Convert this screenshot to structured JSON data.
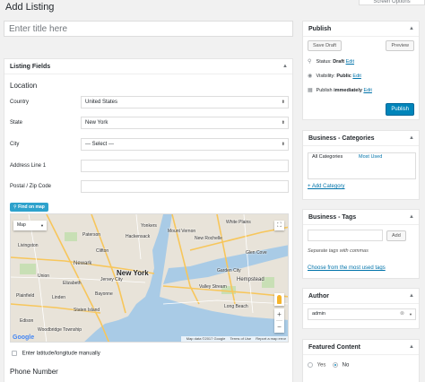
{
  "screen_options": {
    "label": "Screen Options"
  },
  "page": {
    "title": "Add Listing",
    "title_placeholder": "Enter title here"
  },
  "listing_fields": {
    "heading": "Listing Fields",
    "location_heading": "Location",
    "fields": [
      {
        "label": "Country",
        "value": "United States"
      },
      {
        "label": "State",
        "value": "New York"
      },
      {
        "label": "City",
        "value": "--- Select ---"
      },
      {
        "label": "Address Line 1",
        "value": ""
      },
      {
        "label": "Postal / Zip Code",
        "value": ""
      }
    ],
    "find_on_map": "Find on map",
    "manual_latlng": "Enter latitude/longitude manually",
    "phone_heading": "Phone Number"
  },
  "map": {
    "type_label": "Map",
    "places": {
      "newark": "Newark",
      "new_york": "New York",
      "livingston": "Livingston",
      "yonkers": "Yonkers",
      "new_rochelle": "New Rochelle",
      "hempstead": "Hempstead",
      "union": "Union",
      "elizabeth": "Elizabeth",
      "edison": "Edison",
      "woodbridge": "Woodbridge Township",
      "clifton": "Clifton",
      "paterson": "Paterson",
      "hackensack": "Hackensack",
      "glen_cove": "Glen Cove",
      "long_beach": "Long Beach",
      "jersey_city": "Jersey City",
      "bayonne": "Bayonne",
      "plainfield": "Plainfield",
      "linden": "Linden",
      "mount_vernon": "Mount Vernon",
      "white_plains": "White Plains",
      "garden_city": "Garden City",
      "valley_stream": "Valley Stream",
      "staten_island": "Staten Island"
    },
    "logo": "Google",
    "footer_data": "Map data ©2017 Google",
    "footer_terms": "Terms of Use",
    "footer_report": "Report a map error"
  },
  "publish": {
    "heading": "Publish",
    "save_draft": "Save Draft",
    "preview": "Preview",
    "status_label": "Status:",
    "status_value": "Draft",
    "visibility_label": "Visibility:",
    "visibility_value": "Public",
    "publish_label": "Publish",
    "publish_value": "immediately",
    "edit": "Edit",
    "publish_button": "Publish"
  },
  "categories": {
    "heading": "Business - Categories",
    "tab_all": "All Categories",
    "tab_most_used": "Most Used",
    "add_link": "+ Add Category"
  },
  "tags": {
    "heading": "Business - Tags",
    "add_button": "Add",
    "hint": "Separate tags with commas",
    "choose_link": "Choose from the most used tags"
  },
  "author": {
    "heading": "Author",
    "value": "admin"
  },
  "featured": {
    "heading": "Featured Content",
    "yes": "Yes",
    "no": "No",
    "selected": "No"
  },
  "colors": {
    "accent": "#0073aa",
    "primary_button": "#0085ba",
    "map_button": "#2ea2cc"
  }
}
